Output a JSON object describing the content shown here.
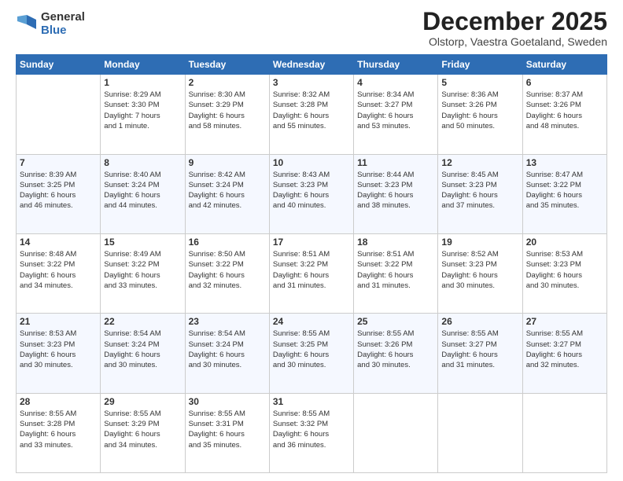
{
  "logo": {
    "general": "General",
    "blue": "Blue"
  },
  "title": "December 2025",
  "location": "Olstorp, Vaestra Goetaland, Sweden",
  "days_of_week": [
    "Sunday",
    "Monday",
    "Tuesday",
    "Wednesday",
    "Thursday",
    "Friday",
    "Saturday"
  ],
  "weeks": [
    [
      {
        "day": "",
        "info": ""
      },
      {
        "day": "1",
        "info": "Sunrise: 8:29 AM\nSunset: 3:30 PM\nDaylight: 7 hours\nand 1 minute."
      },
      {
        "day": "2",
        "info": "Sunrise: 8:30 AM\nSunset: 3:29 PM\nDaylight: 6 hours\nand 58 minutes."
      },
      {
        "day": "3",
        "info": "Sunrise: 8:32 AM\nSunset: 3:28 PM\nDaylight: 6 hours\nand 55 minutes."
      },
      {
        "day": "4",
        "info": "Sunrise: 8:34 AM\nSunset: 3:27 PM\nDaylight: 6 hours\nand 53 minutes."
      },
      {
        "day": "5",
        "info": "Sunrise: 8:36 AM\nSunset: 3:26 PM\nDaylight: 6 hours\nand 50 minutes."
      },
      {
        "day": "6",
        "info": "Sunrise: 8:37 AM\nSunset: 3:26 PM\nDaylight: 6 hours\nand 48 minutes."
      }
    ],
    [
      {
        "day": "7",
        "info": "Sunrise: 8:39 AM\nSunset: 3:25 PM\nDaylight: 6 hours\nand 46 minutes."
      },
      {
        "day": "8",
        "info": "Sunrise: 8:40 AM\nSunset: 3:24 PM\nDaylight: 6 hours\nand 44 minutes."
      },
      {
        "day": "9",
        "info": "Sunrise: 8:42 AM\nSunset: 3:24 PM\nDaylight: 6 hours\nand 42 minutes."
      },
      {
        "day": "10",
        "info": "Sunrise: 8:43 AM\nSunset: 3:23 PM\nDaylight: 6 hours\nand 40 minutes."
      },
      {
        "day": "11",
        "info": "Sunrise: 8:44 AM\nSunset: 3:23 PM\nDaylight: 6 hours\nand 38 minutes."
      },
      {
        "day": "12",
        "info": "Sunrise: 8:45 AM\nSunset: 3:23 PM\nDaylight: 6 hours\nand 37 minutes."
      },
      {
        "day": "13",
        "info": "Sunrise: 8:47 AM\nSunset: 3:22 PM\nDaylight: 6 hours\nand 35 minutes."
      }
    ],
    [
      {
        "day": "14",
        "info": "Sunrise: 8:48 AM\nSunset: 3:22 PM\nDaylight: 6 hours\nand 34 minutes."
      },
      {
        "day": "15",
        "info": "Sunrise: 8:49 AM\nSunset: 3:22 PM\nDaylight: 6 hours\nand 33 minutes."
      },
      {
        "day": "16",
        "info": "Sunrise: 8:50 AM\nSunset: 3:22 PM\nDaylight: 6 hours\nand 32 minutes."
      },
      {
        "day": "17",
        "info": "Sunrise: 8:51 AM\nSunset: 3:22 PM\nDaylight: 6 hours\nand 31 minutes."
      },
      {
        "day": "18",
        "info": "Sunrise: 8:51 AM\nSunset: 3:22 PM\nDaylight: 6 hours\nand 31 minutes."
      },
      {
        "day": "19",
        "info": "Sunrise: 8:52 AM\nSunset: 3:23 PM\nDaylight: 6 hours\nand 30 minutes."
      },
      {
        "day": "20",
        "info": "Sunrise: 8:53 AM\nSunset: 3:23 PM\nDaylight: 6 hours\nand 30 minutes."
      }
    ],
    [
      {
        "day": "21",
        "info": "Sunrise: 8:53 AM\nSunset: 3:23 PM\nDaylight: 6 hours\nand 30 minutes."
      },
      {
        "day": "22",
        "info": "Sunrise: 8:54 AM\nSunset: 3:24 PM\nDaylight: 6 hours\nand 30 minutes."
      },
      {
        "day": "23",
        "info": "Sunrise: 8:54 AM\nSunset: 3:24 PM\nDaylight: 6 hours\nand 30 minutes."
      },
      {
        "day": "24",
        "info": "Sunrise: 8:55 AM\nSunset: 3:25 PM\nDaylight: 6 hours\nand 30 minutes."
      },
      {
        "day": "25",
        "info": "Sunrise: 8:55 AM\nSunset: 3:26 PM\nDaylight: 6 hours\nand 30 minutes."
      },
      {
        "day": "26",
        "info": "Sunrise: 8:55 AM\nSunset: 3:27 PM\nDaylight: 6 hours\nand 31 minutes."
      },
      {
        "day": "27",
        "info": "Sunrise: 8:55 AM\nSunset: 3:27 PM\nDaylight: 6 hours\nand 32 minutes."
      }
    ],
    [
      {
        "day": "28",
        "info": "Sunrise: 8:55 AM\nSunset: 3:28 PM\nDaylight: 6 hours\nand 33 minutes."
      },
      {
        "day": "29",
        "info": "Sunrise: 8:55 AM\nSunset: 3:29 PM\nDaylight: 6 hours\nand 34 minutes."
      },
      {
        "day": "30",
        "info": "Sunrise: 8:55 AM\nSunset: 3:31 PM\nDaylight: 6 hours\nand 35 minutes."
      },
      {
        "day": "31",
        "info": "Sunrise: 8:55 AM\nSunset: 3:32 PM\nDaylight: 6 hours\nand 36 minutes."
      },
      {
        "day": "",
        "info": ""
      },
      {
        "day": "",
        "info": ""
      },
      {
        "day": "",
        "info": ""
      }
    ]
  ]
}
